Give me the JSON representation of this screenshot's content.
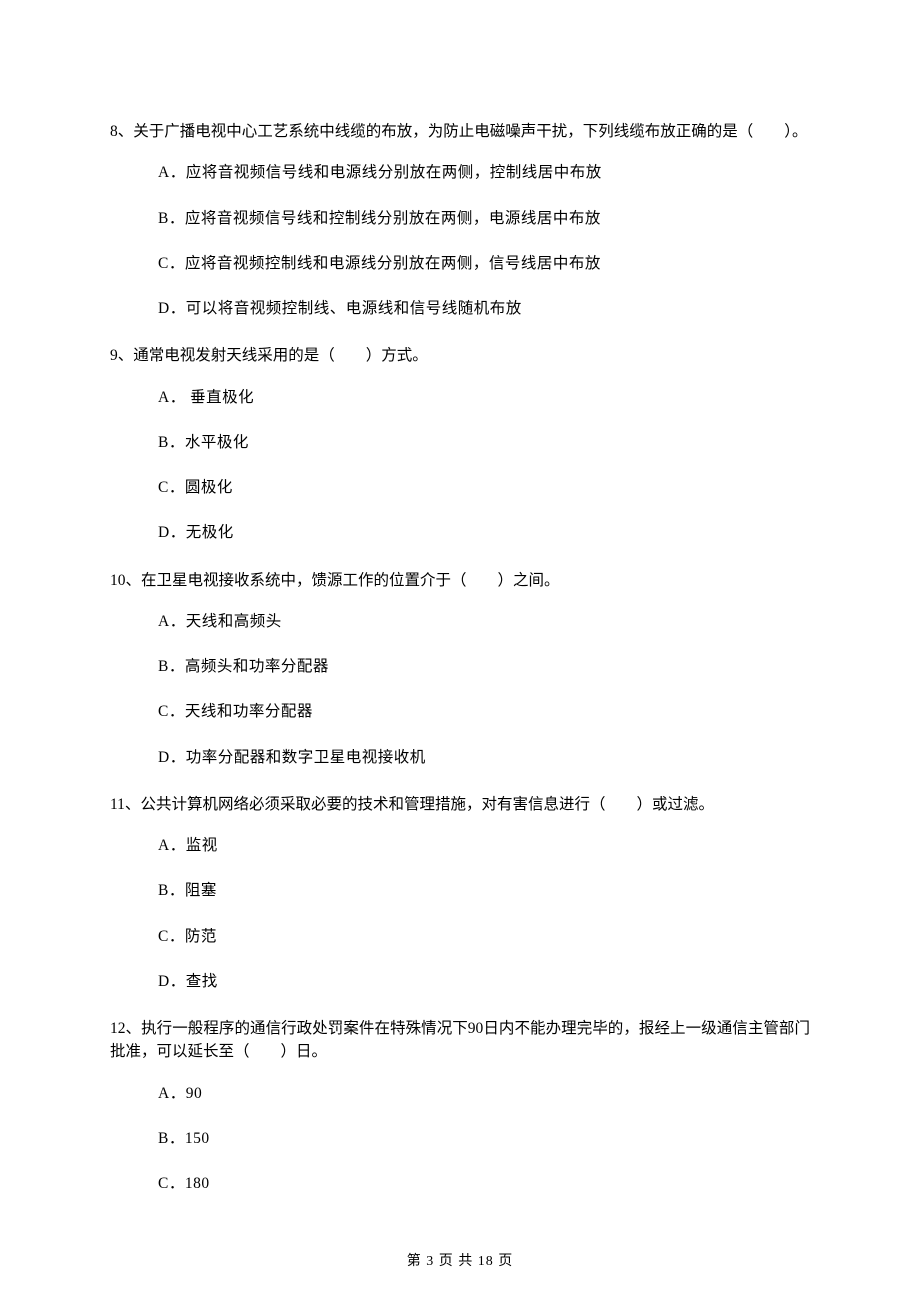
{
  "questions": [
    {
      "number": "8、",
      "text": "关于广播电视中心工艺系统中线缆的布放，为防止电磁噪声干扰，下列线缆布放正确的是（　　）。",
      "options": [
        "A．应将音视频信号线和电源线分别放在两侧，控制线居中布放",
        "B．应将音视频信号线和控制线分别放在两侧，电源线居中布放",
        "C．应将音视频控制线和电源线分别放在两侧，信号线居中布放",
        "D．可以将音视频控制线、电源线和信号线随机布放"
      ]
    },
    {
      "number": "9、",
      "text": "通常电视发射天线采用的是（　　）方式。",
      "options": [
        "A． 垂直极化",
        "B．水平极化",
        "C．圆极化",
        "D．无极化"
      ]
    },
    {
      "number": "10、",
      "text": "在卫星电视接收系统中，馈源工作的位置介于（　　）之间。",
      "options": [
        "A．天线和高频头",
        "B．高频头和功率分配器",
        "C．天线和功率分配器",
        "D．功率分配器和数字卫星电视接收机"
      ]
    },
    {
      "number": "11、",
      "text": "公共计算机网络必须采取必要的技术和管理措施，对有害信息进行（　　）或过滤。",
      "options": [
        "A．监视",
        "B．阻塞",
        "C．防范",
        "D．查找"
      ]
    },
    {
      "number": "12、",
      "text": "执行一般程序的通信行政处罚案件在特殊情况下90日内不能办理完毕的，报经上一级通信主管部门批准，可以延长至（　　）日。",
      "options": [
        "A．90",
        "B．150",
        "C．180"
      ]
    }
  ],
  "footer": "第 3 页 共 18 页"
}
